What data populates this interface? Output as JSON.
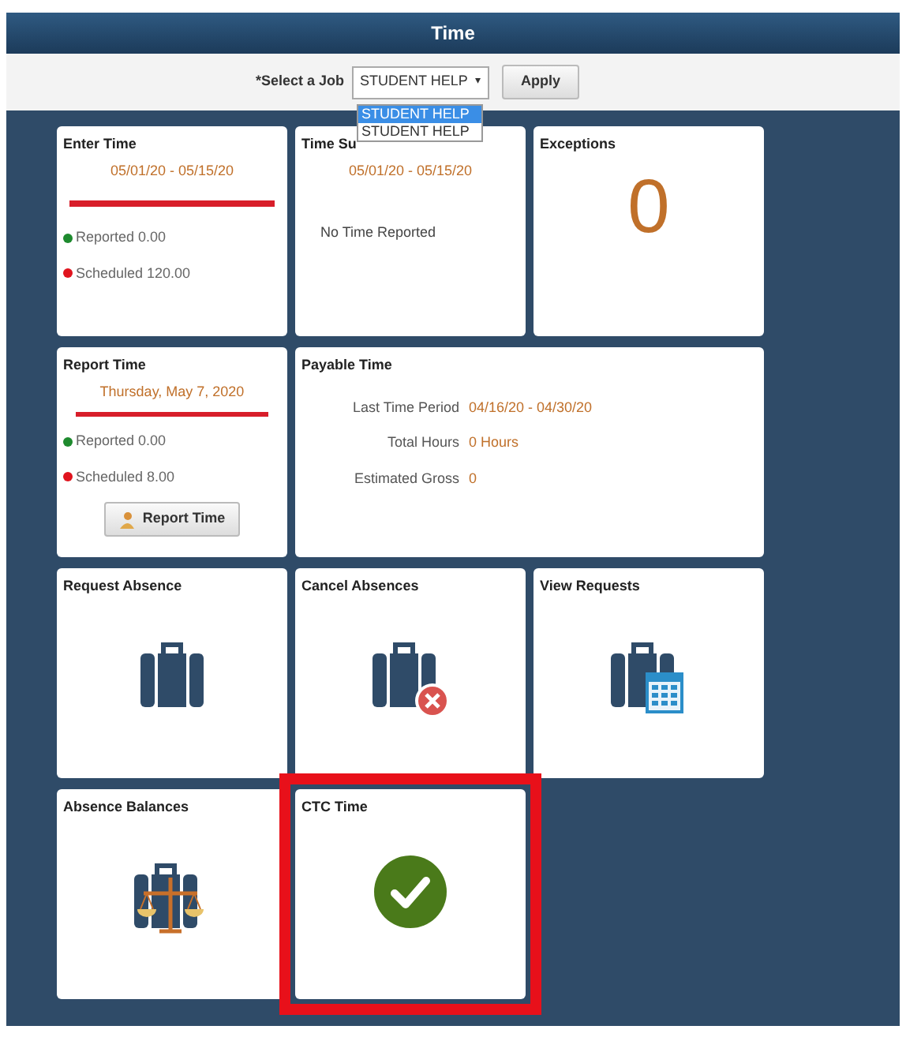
{
  "header": {
    "title": "Time"
  },
  "job_bar": {
    "label": "*Select a Job",
    "select_value": "STUDENT HELP",
    "caret": "▾",
    "apply": "Apply",
    "dropdown": [
      {
        "label": "STUDENT HELP",
        "selected": true
      },
      {
        "label": "STUDENT HELP",
        "selected": false
      }
    ]
  },
  "tiles": [
    {
      "kind": "period",
      "title": "Enter Time",
      "highlighted": false,
      "date": "05/01/20 - 05/15/20",
      "rows": [
        {
          "label": "Reported 0.00",
          "color": "#1e8a2e"
        },
        {
          "label": "Scheduled 120.00",
          "color": "#e0141e"
        }
      ]
    },
    {
      "kind": "summary",
      "title": "Time Su",
      "highlighted": false,
      "date": "05/01/20 - 05/15/20",
      "message": "No Time Reported"
    },
    {
      "kind": "count",
      "title": "Exceptions",
      "highlighted": false,
      "value": "0"
    },
    {
      "kind": "report",
      "title": "Report Time",
      "highlighted": false,
      "date": "Thursday, May 7, 2020",
      "rows": [
        {
          "label": "Reported 0.00",
          "color": "#1e8a2e"
        },
        {
          "label": "Scheduled 8.00",
          "color": "#e0141e"
        }
      ],
      "button": "Report Time"
    },
    {
      "kind": "payable",
      "title": "Payable Time",
      "highlighted": false,
      "fields": [
        {
          "label": "Last Time Period",
          "value": "04/16/20 - 04/30/20"
        },
        {
          "label": "Total Hours",
          "value": "0 Hours"
        },
        {
          "label": "Estimated Gross",
          "value": "0"
        }
      ]
    },
    {
      "kind": "absence",
      "title": "Request Absence",
      "highlighted": false
    },
    {
      "kind": "cancel",
      "title": "Cancel Absences",
      "highlighted": false
    },
    {
      "kind": "requests",
      "title": "View Requests",
      "highlighted": false
    },
    {
      "kind": "balances",
      "title": "Absence Balances",
      "highlighted": false
    },
    {
      "kind": "done",
      "title": "CTC Time",
      "highlighted": true
    }
  ]
}
